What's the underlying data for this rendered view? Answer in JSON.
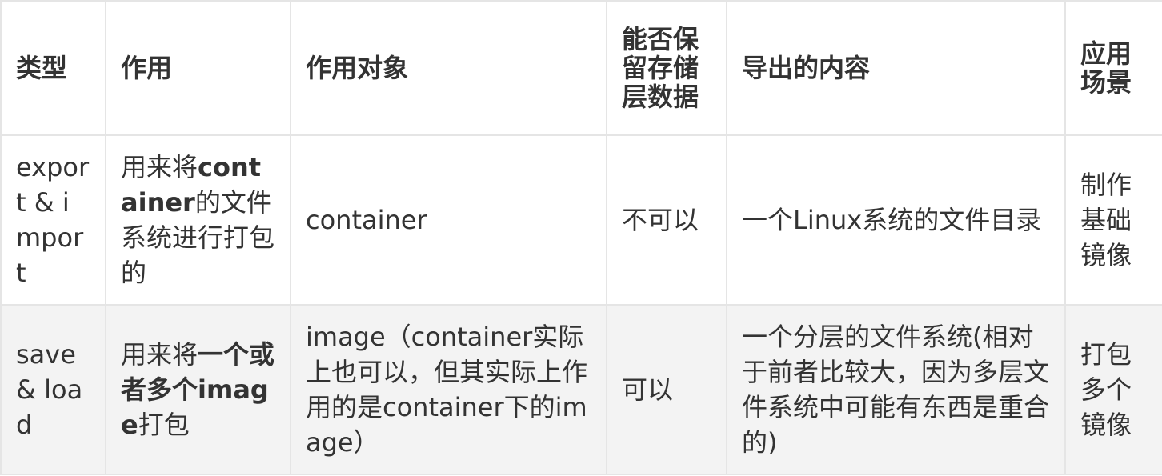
{
  "table": {
    "headers": [
      "类型",
      "作用",
      "作用对象",
      "能否保留存储层数据",
      "导出的内容",
      "应用场景"
    ],
    "rows": [
      {
        "type": "export & import",
        "purpose": {
          "pre": "用来将",
          "bold": "container",
          "post": "的文件系统进行打包的"
        },
        "target": "container",
        "keeps_layers": "不可以",
        "export_content": "一个Linux系统的文件目录",
        "use_case": "制作基础镜像"
      },
      {
        "type": "save & load",
        "purpose": {
          "pre": "用来将",
          "bold1": "一个或者多个image",
          "post": "打包"
        },
        "target": "image（container实际上也可以，但其实际上作用的是container下的image）",
        "keeps_layers": "可以",
        "export_content": "一个分层的文件系统(相对于前者比较大，因为多层文件系统中可能有东西是重合的)",
        "use_case": "打包多个镜像"
      }
    ]
  }
}
